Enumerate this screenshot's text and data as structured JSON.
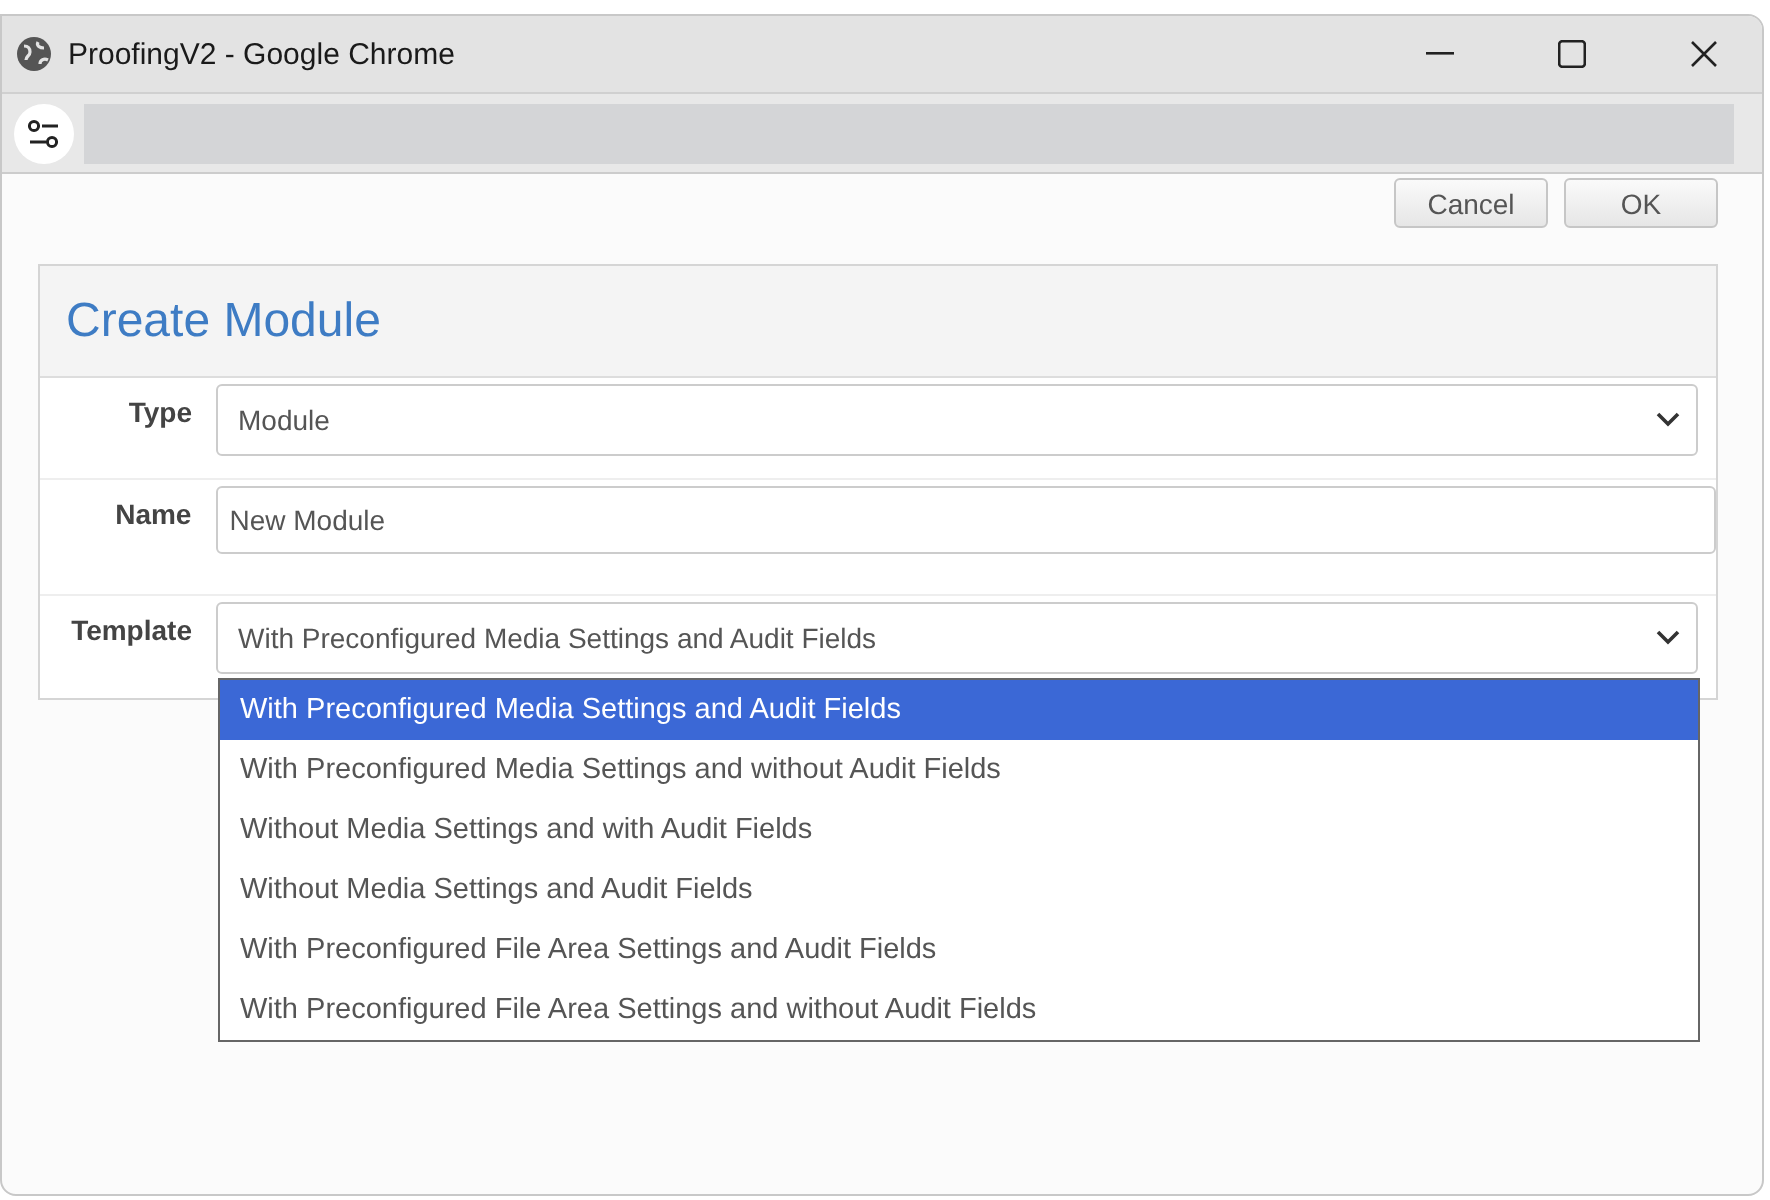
{
  "window": {
    "title": "ProofingV2 - Google Chrome"
  },
  "buttons": [
    {
      "label": "Cancel"
    },
    {
      "label": "OK"
    }
  ],
  "form": {
    "title": "Create Module",
    "fields": [
      {
        "label": "Type",
        "kind": "select",
        "value": "Module"
      },
      {
        "label": "Name",
        "kind": "input",
        "value": "New Module"
      },
      {
        "label": "Template",
        "kind": "select",
        "value": "With Preconfigured Media Settings and Audit Fields",
        "options": [
          {
            "label": "With Preconfigured Media Settings and Audit Fields",
            "selected": true
          },
          {
            "label": "With Preconfigured Media Settings and without Audit Fields",
            "selected": false
          },
          {
            "label": "Without Media Settings and with Audit Fields",
            "selected": false
          },
          {
            "label": "Without Media Settings and Audit Fields",
            "selected": false
          },
          {
            "label": "With Preconfigured File Area Settings and Audit Fields",
            "selected": false
          },
          {
            "label": "With Preconfigured File Area Settings and without Audit Fields",
            "selected": false
          }
        ]
      }
    ]
  }
}
